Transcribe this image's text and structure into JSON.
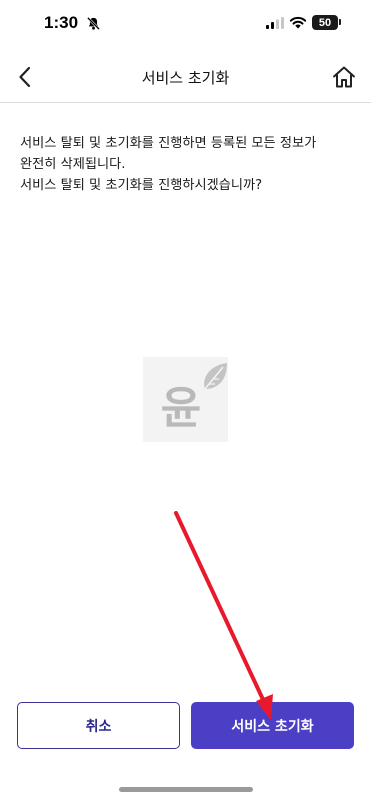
{
  "status_bar": {
    "time": "1:30",
    "battery_level": "50",
    "icons": [
      "bell-off-icon",
      "cellular-signal-icon",
      "wifi-icon",
      "battery-icon"
    ]
  },
  "nav": {
    "title": "서비스 초기화",
    "back_icon": "chevron-left-icon",
    "home_icon": "home-icon"
  },
  "message": {
    "lines": [
      "서비스 탈퇴 및 초기화를 진행하면 등록된 모든 정보가",
      "완전히 삭제됩니다.",
      "서비스 탈퇴 및 초기화를 진행하시겠습니까?"
    ]
  },
  "watermark": {
    "glyph": "윤",
    "icon": "leaf-icon"
  },
  "buttons": {
    "cancel_label": "취소",
    "reset_label": "서비스 초기화"
  },
  "colors": {
    "accent": "#4b3fc6",
    "accent_border": "#3a3296",
    "annotation_arrow": "#e8192c"
  }
}
